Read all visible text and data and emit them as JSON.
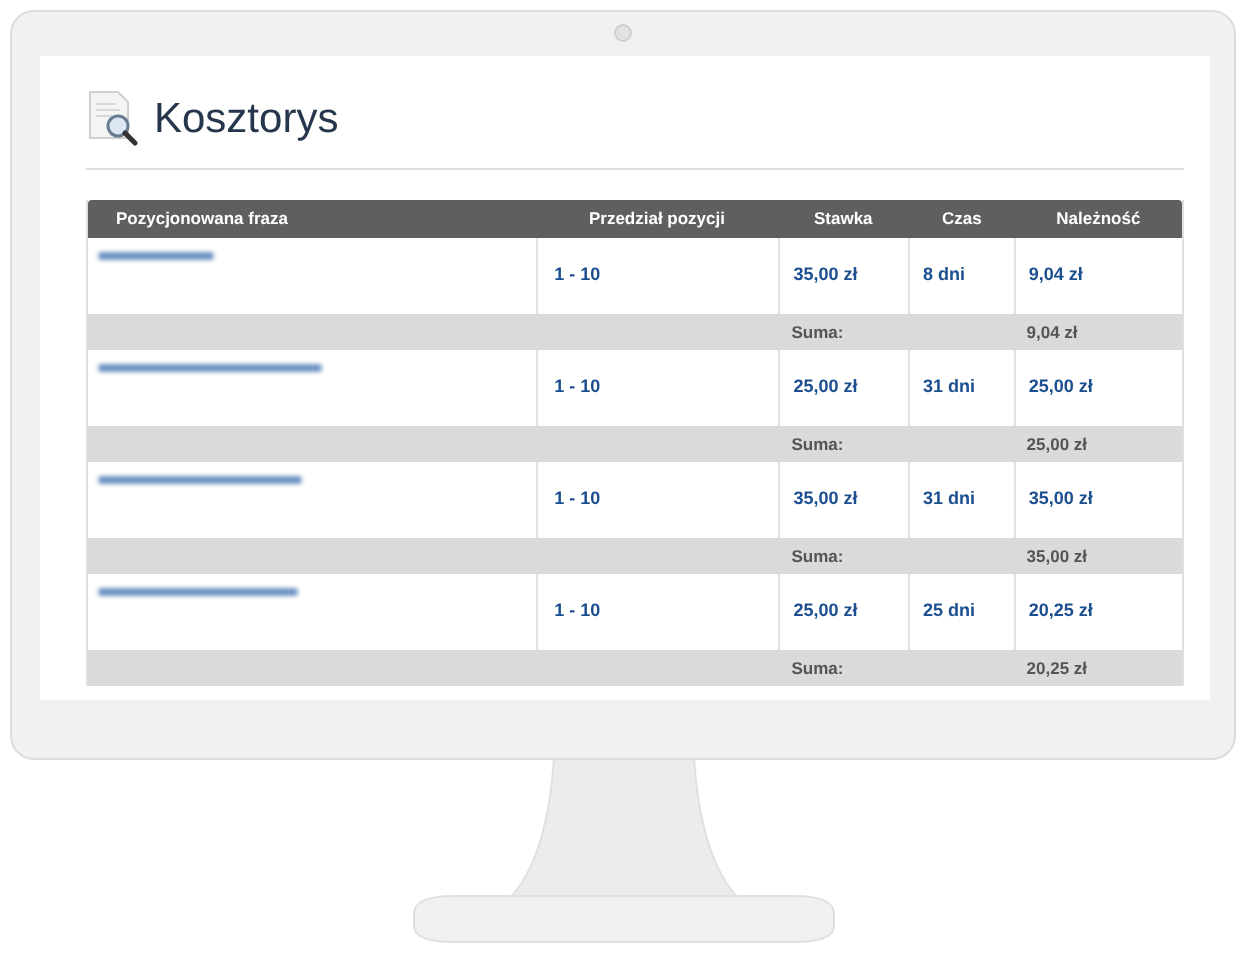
{
  "page": {
    "title": "Kosztorys"
  },
  "table": {
    "columns": [
      "Pozycjonowana fraza",
      "Przedział pozycji",
      "Stawka",
      "Czas",
      "Należność"
    ],
    "rows": [
      {
        "range": "1 - 10",
        "rate": "35,00 zł",
        "time": "8 dni",
        "amount": "9,04 zł",
        "sum_label": "Suma:",
        "sum": "9,04 zł"
      },
      {
        "range": "1 - 10",
        "rate": "25,00 zł",
        "time": "31 dni",
        "amount": "25,00 zł",
        "sum_label": "Suma:",
        "sum": "25,00 zł"
      },
      {
        "range": "1 - 10",
        "rate": "35,00 zł",
        "time": "31 dni",
        "amount": "35,00 zł",
        "sum_label": "Suma:",
        "sum": "35,00 zł"
      },
      {
        "range": "1 - 10",
        "rate": "25,00 zł",
        "time": "25 dni",
        "amount": "20,25 zł",
        "sum_label": "Suma:",
        "sum": "20,25 zł"
      }
    ]
  }
}
